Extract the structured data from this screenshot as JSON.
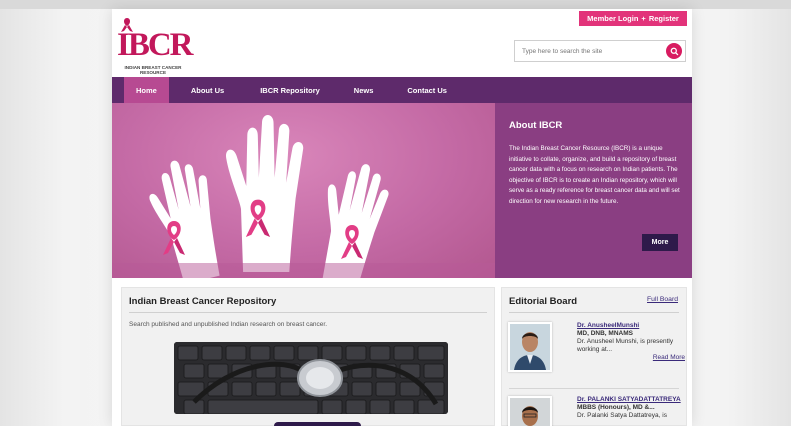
{
  "header": {
    "member_login": "Member Login",
    "separator": "+",
    "register": "Register",
    "logo_text": "IBCR",
    "logo_subtitle": "INDIAN BREAST CANCER RESOURCE",
    "search_placeholder": "Type here to search the site"
  },
  "nav": {
    "items": [
      {
        "label": "Home",
        "active": true
      },
      {
        "label": "About Us"
      },
      {
        "label": "IBCR Repository"
      },
      {
        "label": "News"
      },
      {
        "label": "Contact Us"
      }
    ]
  },
  "about": {
    "title": "About IBCR",
    "text": "The Indian Breast Cancer Resource (IBCR) is a unique initiative to collate, organize, and build a repository of breast cancer data with a focus on research on Indian patients. The objective of IBCR is to create an Indian repository, which will serve as a ready reference for breast cancer data and will set direction for new research in the future.",
    "more_label": "More"
  },
  "repository": {
    "title": "Indian Breast Cancer Repository",
    "description": "Search published and unpublished Indian research on breast cancer."
  },
  "editorial": {
    "title": "Editorial Board",
    "full_board": "Full Board",
    "members": [
      {
        "name": "Dr. AnusheelMunshi",
        "degrees": "MD, DNB, MNAMS",
        "blurb": "Dr. Anusheel Munshi, is presently working at...",
        "read_more": "Read More"
      },
      {
        "name": "Dr. PALANKI SATYADATTATREYA",
        "degrees": "MBBS (Honours), MD &...",
        "blurb": "Dr. Palanki Satya Dattatreya, is"
      }
    ]
  },
  "colors": {
    "accent_pink": "#e2337a",
    "nav_purple": "#5e2a6b",
    "hero_pink": "#c468a4",
    "about_purple": "#8a3e82",
    "button_dark": "#2e1a4a"
  }
}
